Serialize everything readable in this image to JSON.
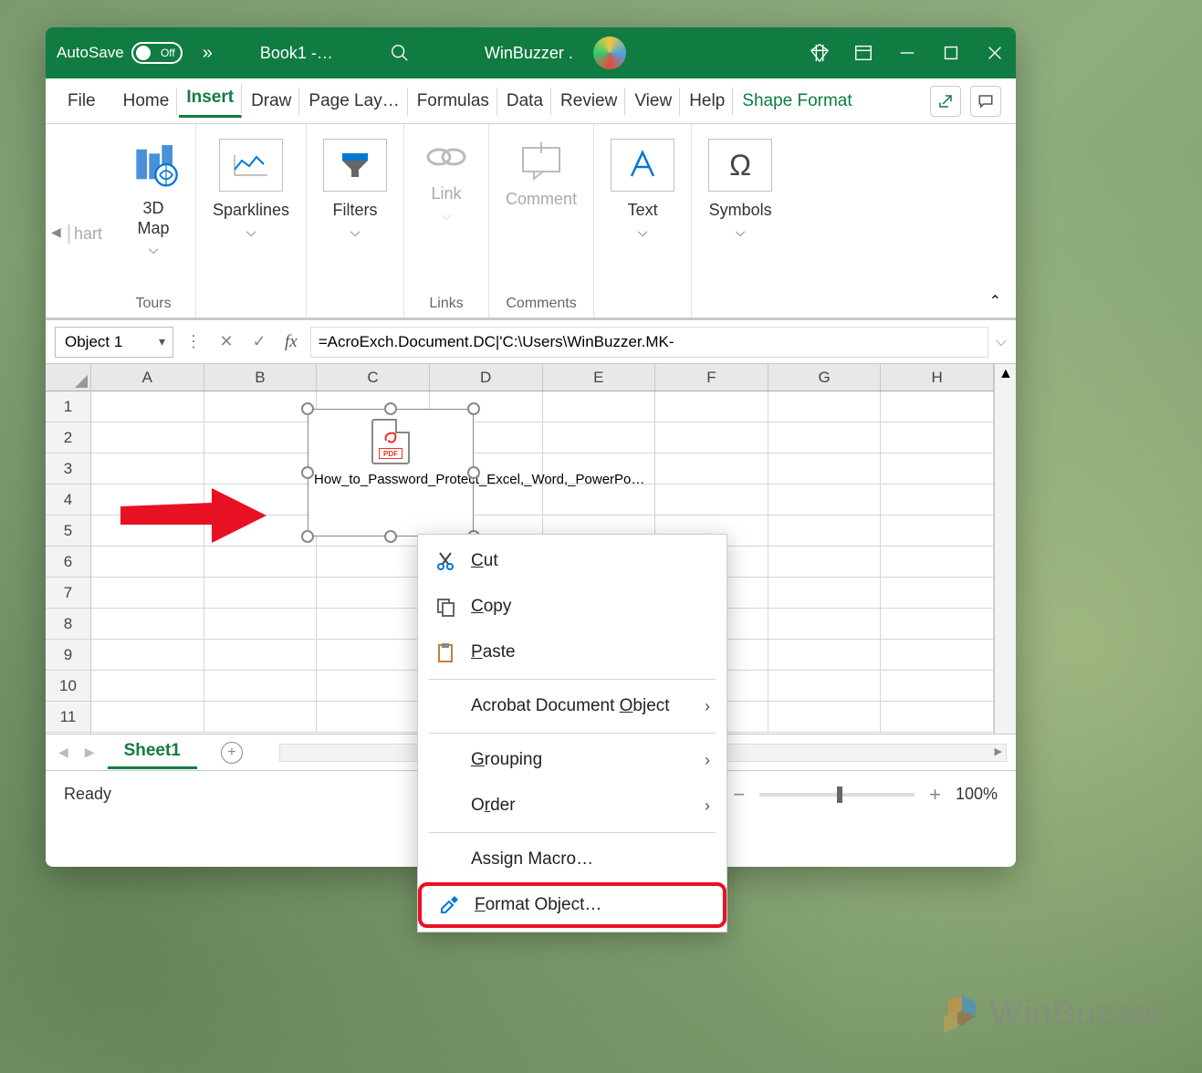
{
  "titlebar": {
    "autosave_label": "AutoSave",
    "autosave_state": "Off",
    "doc_title": "Book1  -…",
    "user_name": "WinBuzzer ."
  },
  "menu": {
    "items": [
      "File",
      "Home",
      "Insert",
      "Draw",
      "Page Lay…",
      "Formulas",
      "Data",
      "Review",
      "View",
      "Help",
      "Shape Format"
    ],
    "active": "Insert"
  },
  "ribbon": {
    "hart": "hart",
    "map_label": "3D\nMap",
    "tours_label": "Tours",
    "sparklines_label": "Sparklines",
    "filters_label": "Filters",
    "link_label": "Link",
    "links_group": "Links",
    "comment_label": "Comment",
    "comments_group": "Comments",
    "text_label": "Text",
    "symbols_label": "Symbols"
  },
  "formula": {
    "name_box": "Object 1",
    "fx_label": "fx",
    "value": "=AcroExch.Document.DC|'C:\\Users\\WinBuzzer.MK-"
  },
  "grid": {
    "cols": [
      "A",
      "B",
      "C",
      "D",
      "E",
      "F",
      "G",
      "H"
    ],
    "rows": [
      "1",
      "2",
      "3",
      "4",
      "5",
      "6",
      "7",
      "8",
      "9",
      "10",
      "11"
    ]
  },
  "object": {
    "pdf_badge": "PDF",
    "caption": "How_to_Password_Protect_Excel,_Word,_PowerPo…"
  },
  "contextmenu": {
    "cut": "Cut",
    "copy": "Copy",
    "paste": "Paste",
    "acrobat": "Acrobat Document Object",
    "grouping": "Grouping",
    "order": "Order",
    "assign_macro": "Assign Macro…",
    "format_object": "Format Object…"
  },
  "sheets": {
    "tab1": "Sheet1"
  },
  "status": {
    "ready": "Ready",
    "zoom": "100%"
  },
  "watermark": {
    "text": "WinBuzzer"
  }
}
